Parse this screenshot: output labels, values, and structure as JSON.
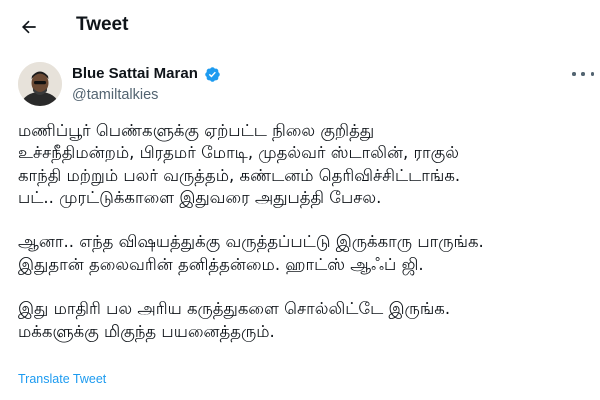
{
  "header": {
    "back_icon": "arrow-left-icon",
    "title": "Tweet"
  },
  "author": {
    "name": "Blue Sattai Maran",
    "handle": "@tamiltalkies",
    "verified_icon": "verified-badge-icon",
    "verified_color": "#1d9bf0",
    "more_icon": "more-horizontal-icon"
  },
  "tweet": {
    "paragraphs": [
      [
        "மணிப்பூர் பெண்களுக்கு ஏற்பட்ட நிலை குறித்து",
        "உச்சநீதிமன்றம், பிரதமர் மோடி, முதல்வர் ஸ்டாலின், ராகுல்",
        "காந்தி மற்றும் பலர் வருத்தம், கண்டனம் தெரிவிச்சிட்டாங்க.",
        "பட்.. முரட்டுக்காளை இதுவரை அதுபத்தி பேசல."
      ],
      [
        "ஆனா.. எந்த விஷயத்துக்கு வருத்தப்பட்டு இருக்காரு பாருங்க.",
        "இதுதான் தலைவரின் தனித்தன்மை. ஹாட்ஸ் ஆஃப் ஜி."
      ],
      [
        "இது மாதிரி பல அரிய கருத்துகளை சொல்லிட்டே இருங்க.",
        "மக்களுக்கு மிகுந்த பயனைத்தரும்."
      ]
    ]
  },
  "translate_label": "Translate Tweet",
  "colors": {
    "text": "#0f1419",
    "secondary": "#536471",
    "link": "#1d9bf0",
    "background": "#ffffff"
  }
}
